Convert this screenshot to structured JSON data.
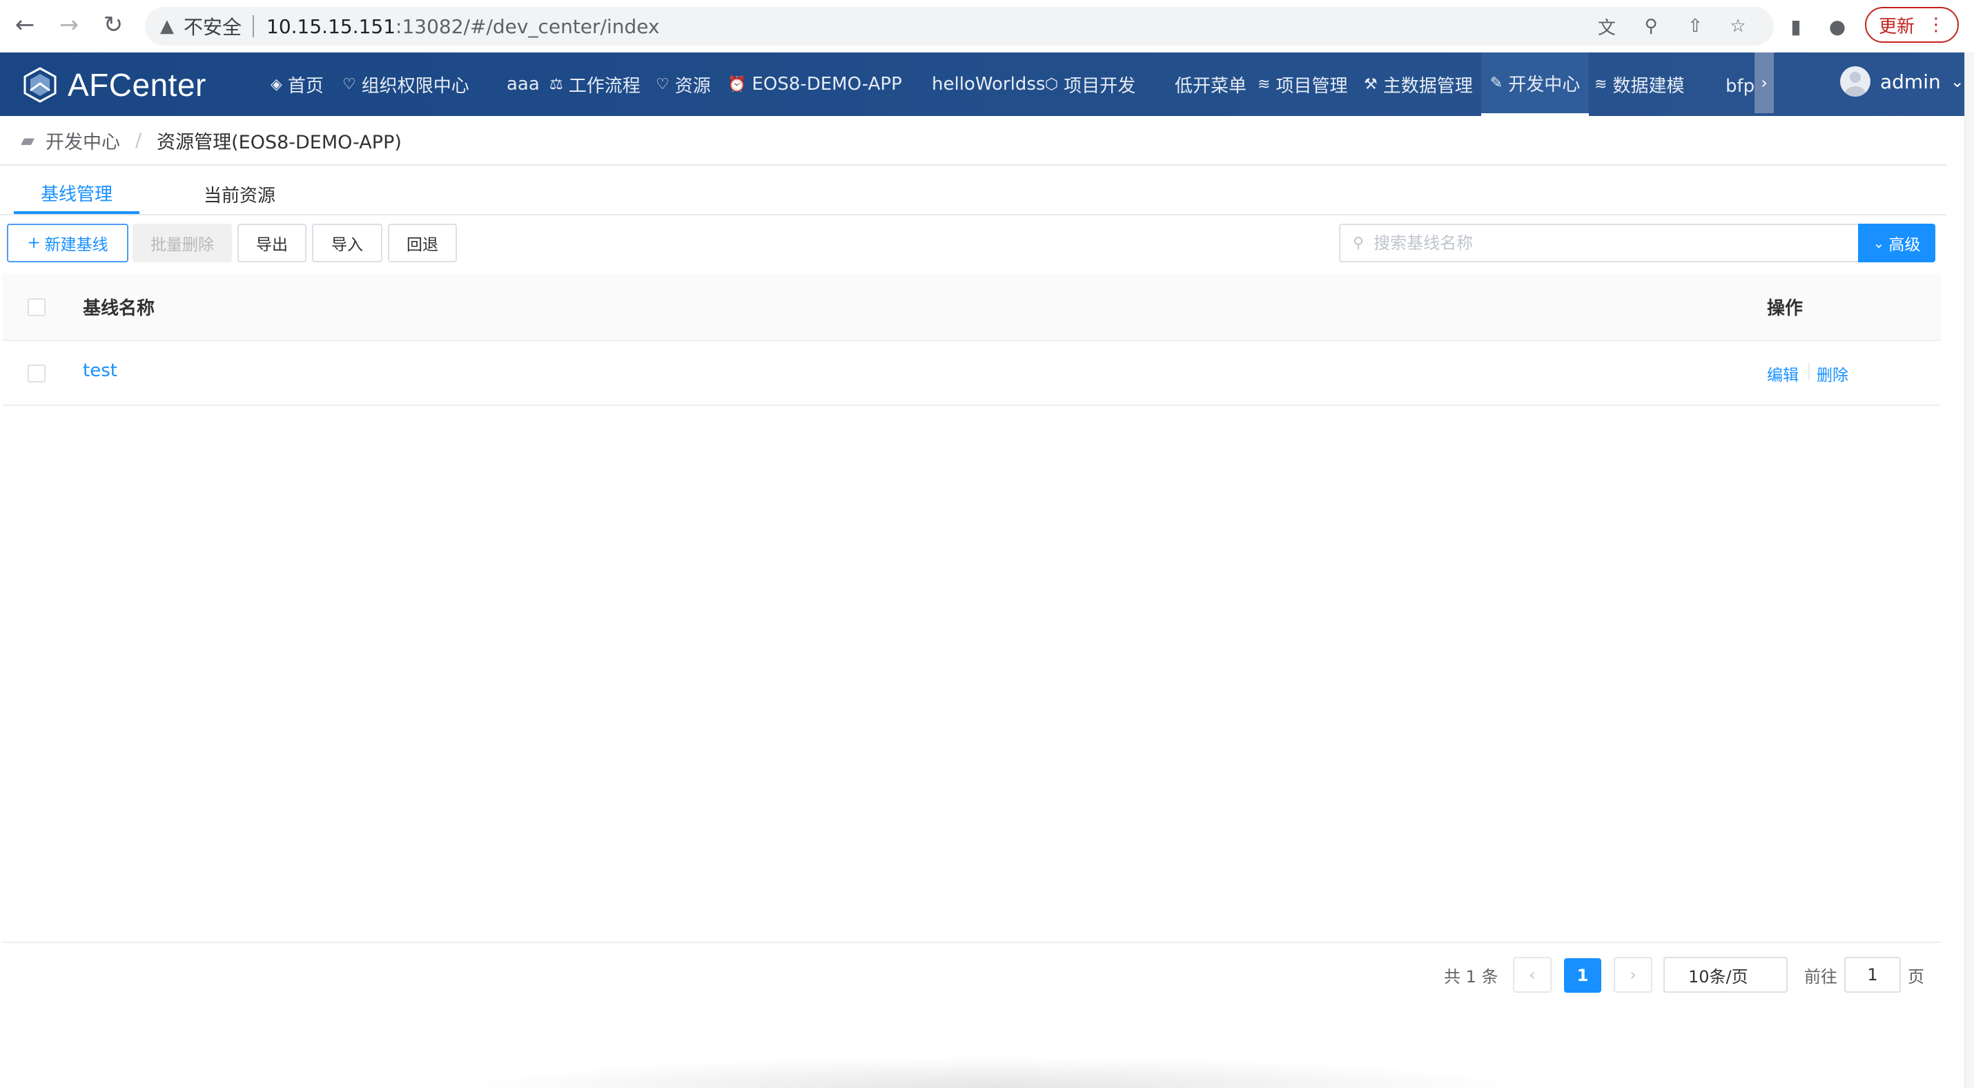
{
  "browser": {
    "insecure_label": "不安全",
    "url_host": "10.15.15.151",
    "url_rest": ":13082/#/dev_center/index",
    "update_label": "更新"
  },
  "app": {
    "logo_text": "AFCenter",
    "menu": [
      {
        "icon": "gem-icon",
        "glyph": "◈",
        "label": "首页"
      },
      {
        "icon": "shield-icon",
        "glyph": "♡",
        "label": "组织权限中心"
      },
      {
        "icon": "",
        "glyph": "",
        "label": "aaa"
      },
      {
        "icon": "scale-icon",
        "glyph": "⚖",
        "label": "工作流程"
      },
      {
        "icon": "shield-icon",
        "glyph": "♡",
        "label": "资源"
      },
      {
        "icon": "alarm-icon",
        "glyph": "⏰",
        "label": "EOS8-DEMO-APP"
      },
      {
        "icon": "",
        "glyph": "",
        "label": "helloWorldss"
      },
      {
        "icon": "cube-icon",
        "glyph": "⬡",
        "label": "项目开发"
      },
      {
        "icon": "",
        "glyph": "",
        "label": "低开菜单"
      },
      {
        "icon": "layers-icon",
        "glyph": "≋",
        "label": "项目管理"
      },
      {
        "icon": "tools-icon",
        "glyph": "⚒",
        "label": "主数据管理"
      },
      {
        "icon": "edit-icon",
        "glyph": "✎",
        "label": "开发中心",
        "active": true
      },
      {
        "icon": "layers-icon",
        "glyph": "≋",
        "label": "数据建模"
      },
      {
        "icon": "",
        "glyph": "",
        "label": "bfp下"
      }
    ],
    "user_name": "admin"
  },
  "breadcrumb": {
    "root": "开发中心",
    "separator": "/",
    "current": "资源管理(EOS8-DEMO-APP)"
  },
  "tabs": [
    {
      "label": "基线管理",
      "active": true
    },
    {
      "label": "当前资源",
      "active": false
    }
  ],
  "toolbar": {
    "new_label": "新建基线",
    "batch_delete_label": "批量删除",
    "export_label": "导出",
    "import_label": "导入",
    "rollback_label": "回退",
    "search_placeholder": "搜索基线名称",
    "advanced_label": "高级"
  },
  "table": {
    "columns": [
      "基线名称",
      "操作"
    ],
    "rows": [
      {
        "name": "test",
        "actions": [
          "编辑",
          "删除"
        ]
      }
    ]
  },
  "pagination": {
    "total_text": "共 1 条",
    "current_page": "1",
    "page_size": "10条/页",
    "goto_label": "前往",
    "goto_value": "1",
    "page_suffix": "页"
  },
  "colors": {
    "header_bg": "#1f4e8c",
    "accent": "#1890ff",
    "update_red": "#c5221f"
  }
}
